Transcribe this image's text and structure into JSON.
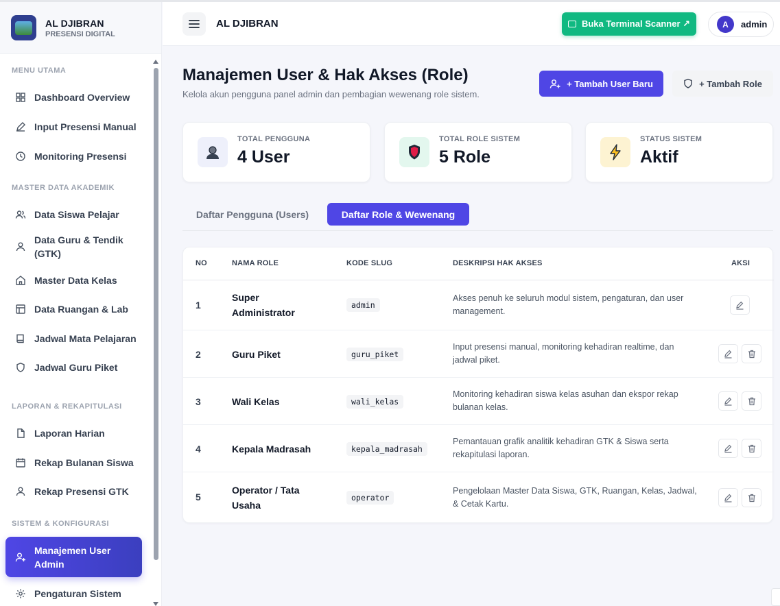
{
  "brand": {
    "name": "AL DJIBRAN",
    "subtitle": "PRESENSI DIGITAL"
  },
  "sidebar": {
    "sections": [
      "MENU UTAMA",
      "MASTER DATA AKADEMIK",
      "LAPORAN & REKAPITULASI",
      "SISTEM & KONFIGURASI"
    ],
    "items": [
      {
        "label": "Dashboard Overview",
        "icon": "grid-icon"
      },
      {
        "label": "Input Presensi Manual",
        "icon": "pencil-icon"
      },
      {
        "label": "Monitoring Presensi",
        "icon": "clock-icon"
      },
      {
        "label": "Data Siswa Pelajar",
        "icon": "users-icon"
      },
      {
        "label": "Data Guru & Tendik (GTK)",
        "icon": "user-icon"
      },
      {
        "label": "Master Data Kelas",
        "icon": "home-icon"
      },
      {
        "label": "Data Ruangan & Lab",
        "icon": "layout-icon"
      },
      {
        "label": "Jadwal Mata Pelajaran",
        "icon": "book-icon"
      },
      {
        "label": "Jadwal Guru Piket",
        "icon": "shield-icon"
      },
      {
        "label": "Laporan Harian",
        "icon": "file-icon"
      },
      {
        "label": "Rekap Bulanan Siswa",
        "icon": "calendar-icon"
      },
      {
        "label": "Rekap Presensi GTK",
        "icon": "user-icon"
      },
      {
        "label": "Manajemen User Admin",
        "icon": "user-plus-icon",
        "active": true
      },
      {
        "label": "Pengaturan Sistem",
        "icon": "gear-icon"
      }
    ]
  },
  "header": {
    "title": "AL DJIBRAN",
    "scanner_button": "Buka Terminal Scanner ↗",
    "user_initial": "A",
    "user_name": "admin"
  },
  "page": {
    "title": "Manajemen User & Hak Akses (Role)",
    "subtitle": "Kelola akun pengguna panel admin dan pembagian wewenang role sistem.",
    "add_user_button": "+ Tambah User Baru",
    "add_role_button": "+ Tambah Role"
  },
  "stats": [
    {
      "label": "TOTAL PENGGUNA",
      "value": "4 User",
      "icon": "user-avatar-icon",
      "color": "#eef0fb"
    },
    {
      "label": "TOTAL ROLE SISTEM",
      "value": "5 Role",
      "icon": "shield-badge-icon",
      "color": "#e3f7ee"
    },
    {
      "label": "STATUS SISTEM",
      "value": "Aktif",
      "icon": "lightning-icon",
      "color": "#fdf3d2"
    }
  ],
  "tabs": {
    "users": "Daftar Pengguna (Users)",
    "roles": "Daftar Role & Wewenang"
  },
  "table": {
    "headers": {
      "no": "NO",
      "name": "NAMA ROLE",
      "slug": "KODE SLUG",
      "desc": "DESKRIPSI HAK AKSES",
      "actions": "AKSI"
    },
    "rows": [
      {
        "no": "1",
        "name": "Super Administrator",
        "slug": "admin",
        "desc": "Akses penuh ke seluruh modul sistem, pengaturan, dan user management.",
        "deletable": false
      },
      {
        "no": "2",
        "name": "Guru Piket",
        "slug": "guru_piket",
        "desc": "Input presensi manual, monitoring kehadiran realtime, dan jadwal piket.",
        "deletable": true
      },
      {
        "no": "3",
        "name": "Wali Kelas",
        "slug": "wali_kelas",
        "desc": "Monitoring kehadiran siswa kelas asuhan dan ekspor rekap bulanan kelas.",
        "deletable": true
      },
      {
        "no": "4",
        "name": "Kepala Madrasah",
        "slug": "kepala_madrasah",
        "desc": "Pemantauan grafik analitik kehadiran GTK & Siswa serta rekapitulasi laporan.",
        "deletable": true
      },
      {
        "no": "5",
        "name": "Operator / Tata Usaha",
        "slug": "operator",
        "desc": "Pengelolaan Master Data Siswa, GTK, Ruangan, Kelas, Jadwal, & Cetak Kartu.",
        "deletable": true
      }
    ]
  },
  "colors": {
    "primary": "#4f46e5",
    "success": "#10b981"
  }
}
